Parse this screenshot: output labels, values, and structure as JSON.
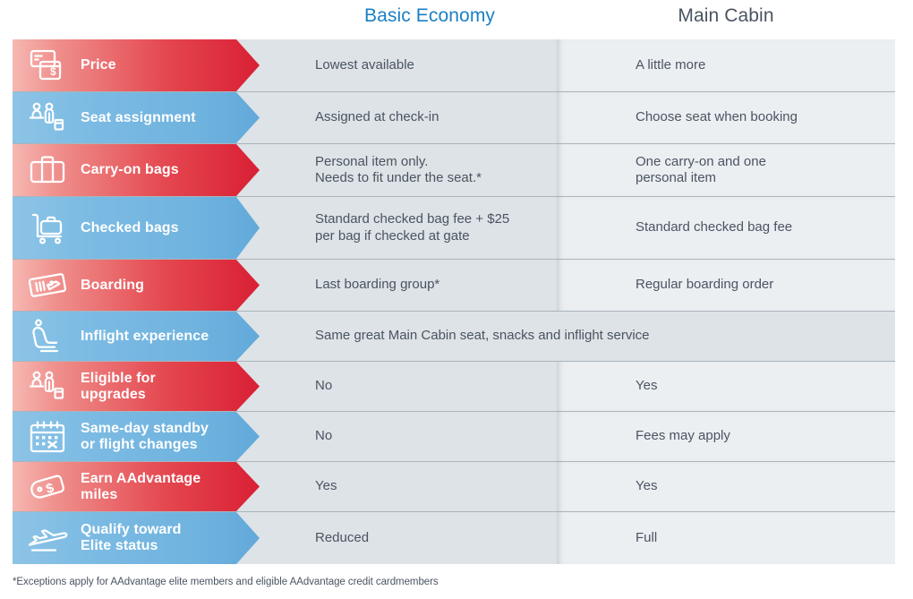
{
  "header": {
    "basic_economy": "Basic Economy",
    "main_cabin": "Main Cabin",
    "basic_color": "#1b7fc4",
    "main_color": "#4a5460"
  },
  "rows": [
    {
      "icon": "credit-card-dollar-icon",
      "label": "Price",
      "accent": "red",
      "basic": "Lowest available",
      "main": "A little more"
    },
    {
      "icon": "seat-assignment-people-icon",
      "label": "Seat assignment",
      "accent": "blue",
      "basic": "Assigned at check-in",
      "main": "Choose seat when booking"
    },
    {
      "icon": "suitcase-icon",
      "label": "Carry-on bags",
      "accent": "red",
      "basic": "Personal item only.\nNeeds to fit under the seat.*",
      "main": "One carry-on and one\npersonal item"
    },
    {
      "icon": "luggage-cart-icon",
      "label": "Checked bags",
      "accent": "blue",
      "basic": "Standard checked bag fee + $25\nper bag if checked at gate",
      "main": "Standard checked bag fee"
    },
    {
      "icon": "boarding-pass-icon",
      "label": "Boarding",
      "accent": "red",
      "basic": "Last boarding group*",
      "main": "Regular boarding order"
    },
    {
      "icon": "airline-seat-icon",
      "label": "Inflight experience",
      "accent": "blue",
      "span": "Same great Main Cabin seat, snacks and inflight service"
    },
    {
      "icon": "upgrade-people-icon",
      "label": "Eligible for\nupgrades",
      "accent": "red",
      "basic": "No",
      "main": "Yes"
    },
    {
      "icon": "calendar-x-icon",
      "label": "Same-day standby\nor flight changes",
      "accent": "blue",
      "basic": "No",
      "main": "Fees may apply"
    },
    {
      "icon": "price-tag-dollar-icon",
      "label": "Earn AAdvantage\nmiles",
      "accent": "red",
      "basic": "Yes",
      "main": "Yes"
    },
    {
      "icon": "airplane-icon",
      "label": "Qualify toward\nElite status",
      "accent": "blue",
      "basic": "Reduced",
      "main": "Full"
    }
  ],
  "footnote": "*Exceptions apply for AAdvantage elite members and eligible AAdvantage credit cardmembers"
}
